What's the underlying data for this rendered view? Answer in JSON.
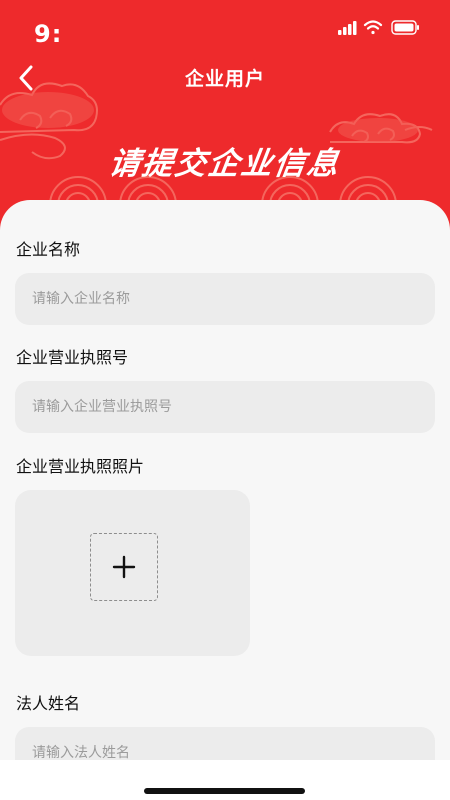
{
  "colors": {
    "brand_red": "#ee2a2c",
    "sheet_bg": "#f7f7f7",
    "field_bg": "#ececec",
    "placeholder": "#9b9b9b"
  },
  "status_bar": {
    "time": "9:",
    "icons": [
      "signal-icon",
      "wifi-icon",
      "battery-icon"
    ]
  },
  "nav": {
    "back_icon": "chevron-left-icon",
    "title": "企业用户"
  },
  "banner": {
    "title": "请提交企业信息"
  },
  "form": {
    "company_name": {
      "label": "企业名称",
      "placeholder": "请输入企业名称"
    },
    "license_number": {
      "label": "企业营业执照号",
      "placeholder": "请输入企业营业执照号"
    },
    "license_photo": {
      "label": "企业营业执照照片",
      "icon": "plus-icon"
    },
    "legal_person": {
      "label": "法人姓名",
      "placeholder": "请输入法人姓名"
    }
  }
}
